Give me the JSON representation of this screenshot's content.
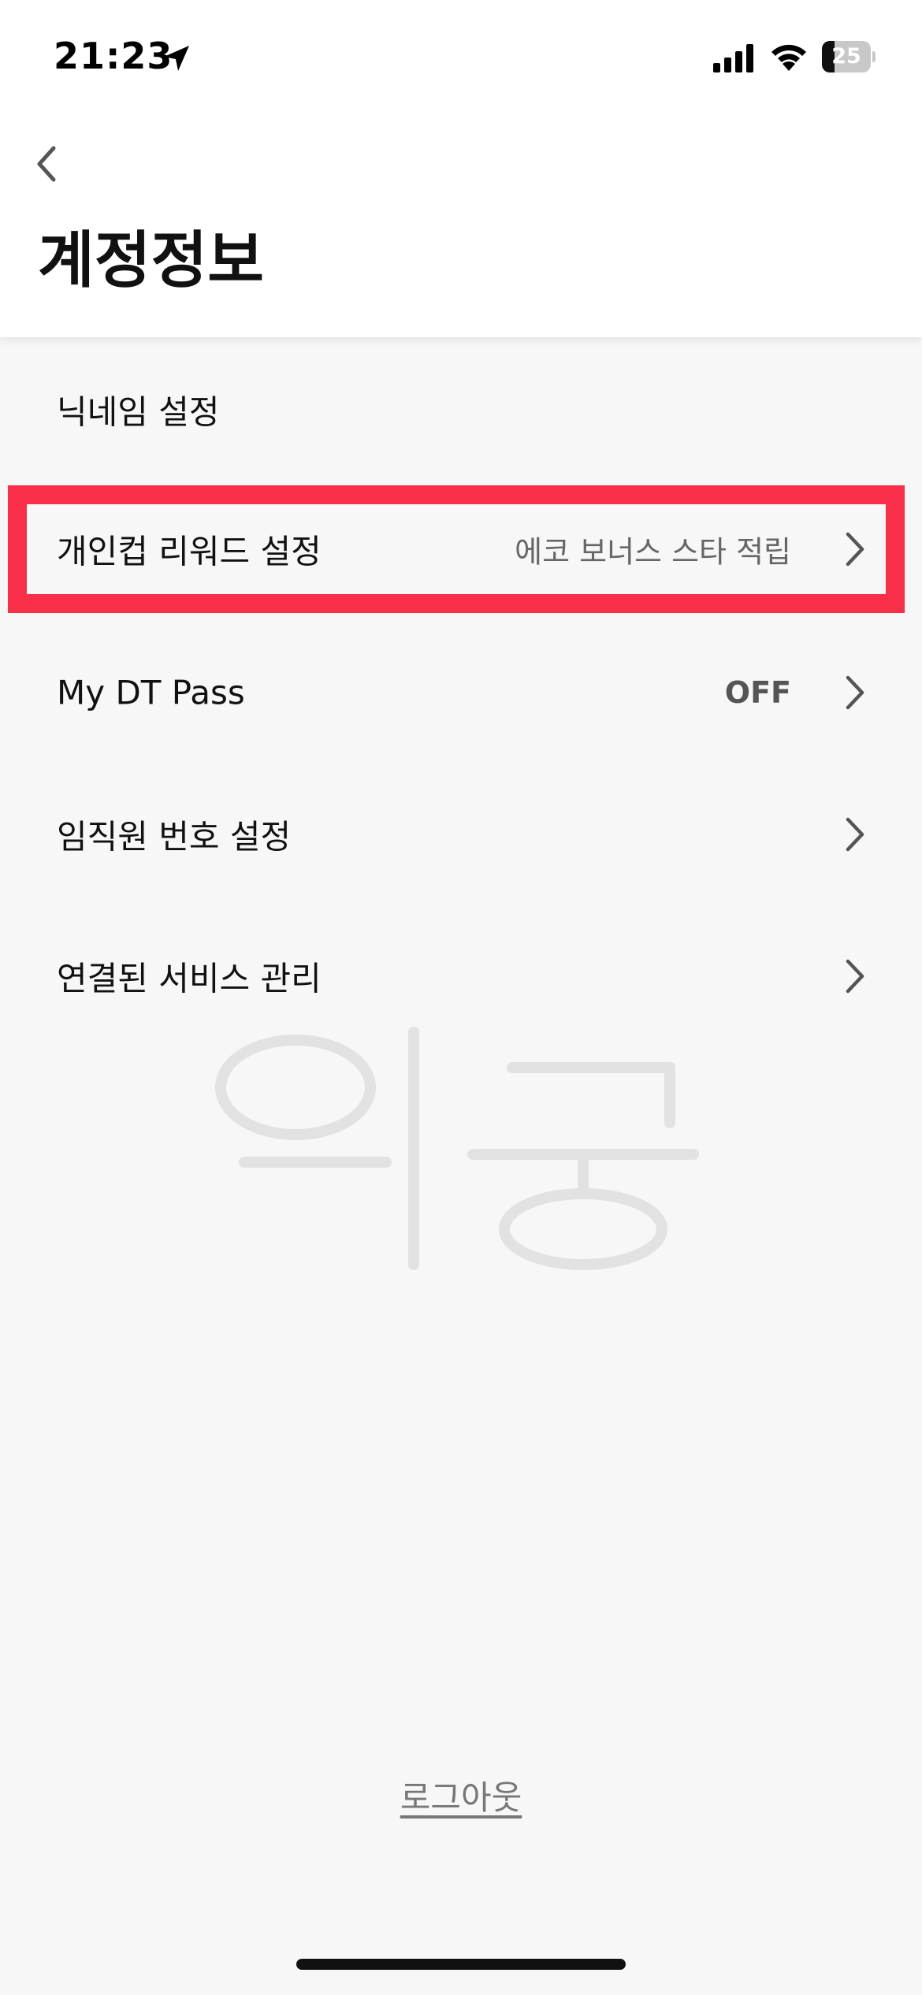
{
  "status_bar": {
    "time": "21:23",
    "battery_level": "25",
    "icons": [
      "location-arrow-icon",
      "cellular-signal-icon",
      "wifi-icon",
      "battery-icon"
    ]
  },
  "header": {
    "back_icon": "chevron-left-icon",
    "title": "계정정보"
  },
  "menu": {
    "items": [
      {
        "label": "닉네임 설정",
        "value": "",
        "has_chevron": false
      },
      {
        "label": "개인컵 리워드 설정",
        "value": "에코 보너스 스타 적립",
        "has_chevron": true,
        "highlighted": true
      },
      {
        "label": "My DT Pass",
        "value": "OFF",
        "has_chevron": true
      },
      {
        "label": "임직원 번호 설정",
        "value": "",
        "has_chevron": true
      },
      {
        "label": "연결된 서비스 관리",
        "value": "",
        "has_chevron": true
      }
    ]
  },
  "footer": {
    "logout_label": "로그아웃"
  },
  "colors": {
    "highlight": "#f92e48",
    "background": "#f7f7f7",
    "header_background": "#ffffff",
    "secondary_text": "#666666"
  }
}
